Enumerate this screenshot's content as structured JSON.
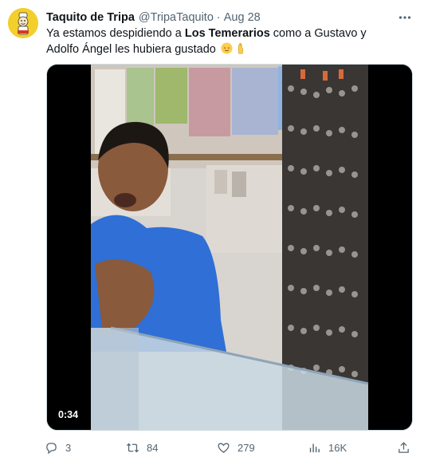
{
  "author": {
    "display_name": "Taquito de Tripa",
    "handle": "@TripaTaquito",
    "separator": "·",
    "date": "Aug 28",
    "avatar_icon": "taco-character-avatar"
  },
  "tweet": {
    "text_part1": "Ya estamos despidiendo a ",
    "text_bold": "Los Temerarios",
    "text_part2": " como a Gustavo y Adolfo Ángel les hubiera gustado",
    "emojis": [
      "relieved-face-emoji",
      "pinched-fingers-emoji"
    ]
  },
  "media": {
    "type": "video",
    "duration": "0:34"
  },
  "actions": {
    "replies": "3",
    "reposts": "84",
    "likes": "279",
    "views": "16K"
  },
  "colors": {
    "text": "#0f1419",
    "secondary": "#536471",
    "border": "#cfd9de",
    "avatar_bg": "#f2cf2a"
  }
}
